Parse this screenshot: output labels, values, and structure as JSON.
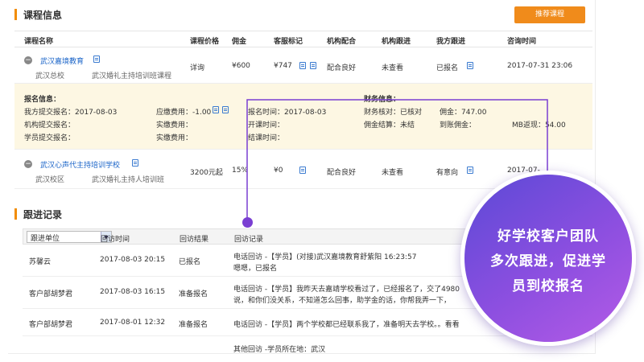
{
  "course_section": {
    "title": "课程信息",
    "recommend_button": "推荐课程",
    "headers": [
      "课程名称",
      "课程价格",
      "佣金",
      "客服标记",
      "机构配合",
      "机构跟进",
      "我方跟进",
      "咨询时间"
    ],
    "rows": [
      {
        "name": "武汉嘉境教育",
        "campus": "武汉总校",
        "course": "武汉婚礼主持培训班课程",
        "price": "详询",
        "commission": "¥600",
        "mark": "¥747",
        "cooperation": "配合良好",
        "org_follow": "未查看",
        "our_follow": "已报名",
        "time": "2017-07-31 23:06"
      },
      {
        "name": "武汉心声代主持培训学校",
        "campus": "武汉校区",
        "course": "武汉婚礼主持人培训班",
        "price": "3200元起",
        "commission": "15%",
        "mark": "¥0",
        "cooperation": "配合良好",
        "org_follow": "未查看",
        "our_follow": "有意向",
        "time": "2017-07-"
      }
    ],
    "detail": {
      "signup_title": "报名信息：",
      "finance_title": "财务信息：",
      "our_submit": "我方提交报名：2017-08-03",
      "org_submit": "机构提交报名：",
      "student_submit": "学员提交报名：",
      "fee_due": "应缴费用：-1.00",
      "fee_paid1": "实缴费用：",
      "fee_paid2": "实缴费用：",
      "signup_time": "报名时间：2017-08-03",
      "start_time": "开课时间：",
      "end_time": "结课时间：",
      "finance_check": "财务核对：已核对",
      "commission_settle": "佣金结算：未结",
      "commission": "佣金：747.00",
      "commission_arrived": "到账佣金：",
      "mb_rebate": "MB返现：54.00"
    }
  },
  "follow_section": {
    "title": "跟进记录",
    "select_value": "跟进单位",
    "headers": [
      "回访时间",
      "回访结果",
      "回访记录"
    ],
    "rows": [
      {
        "unit": "苏馨云",
        "time": "2017-08-03  20:15",
        "result": "已报名",
        "record1": "电话回访 -【学员】(对接)武汉嘉境教育舒紫阳 16:23:57",
        "record2": "嗯嗯，已报名"
      },
      {
        "unit": "客户部胡梦君",
        "time": "2017-08-03  16:15",
        "result": "准备报名",
        "record1": "电话回访 -【学员】我昨天去嘉靖学校看过了，已经报名了，交了4980",
        "record2": "说，和你们没关系，不知道怎么回事，助学金的话，你帮我弄一下，"
      },
      {
        "unit": "客户部胡梦君",
        "time": "2017-08-01  12:32",
        "result": "准备报名",
        "record1": "电话回访 -【学员】两个学校都已经联系我了，准备明天去学校。。看看",
        "record2": ""
      },
      {
        "unit": "",
        "time": "",
        "result": "",
        "record1": "其他回访 -学员所在地：武汉",
        "record2": ""
      }
    ]
  },
  "callout": {
    "line1": "好学校客户团队",
    "line2": "多次跟进，促进学",
    "line3": "员到校报名"
  },
  "colors": {
    "accent_orange": "#f08b1b",
    "link_blue": "#1a64c8",
    "callout_purple": "#7a3fd2",
    "detail_bg": "#fdf7e3"
  }
}
